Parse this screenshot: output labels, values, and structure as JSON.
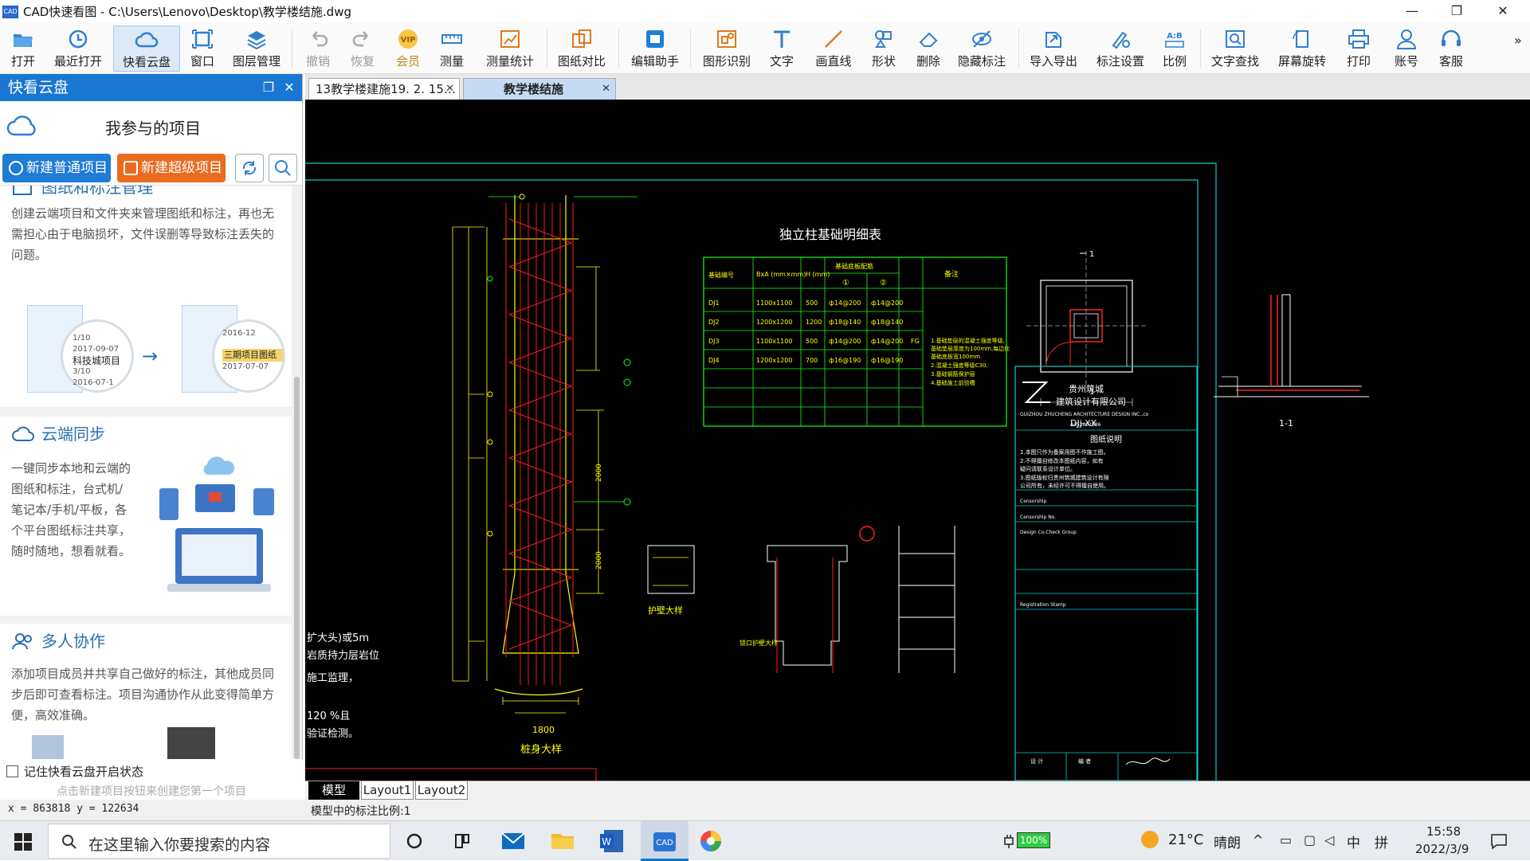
{
  "window": {
    "app_icon": "CAD",
    "title": "CAD快速看图 - C:\\Users\\Lenovo\\Desktop\\教学楼结施.dwg",
    "minimize": "—",
    "restore": "❐",
    "close": "✕"
  },
  "toolbar": {
    "items": [
      {
        "label": "打开",
        "icon": "folder-open-icon"
      },
      {
        "label": "最近打开",
        "icon": "history-icon"
      },
      {
        "label": "快看云盘",
        "icon": "cloud-icon"
      },
      {
        "label": "窗口",
        "icon": "window-icon"
      },
      {
        "label": "图层管理",
        "icon": "layers-icon"
      },
      {
        "label": "撤销",
        "icon": "undo-icon"
      },
      {
        "label": "恢复",
        "icon": "redo-icon"
      },
      {
        "label": "会员",
        "icon": "vip-icon"
      },
      {
        "label": "测量",
        "icon": "ruler-icon"
      },
      {
        "label": "测量统计",
        "icon": "measure-stats-icon"
      },
      {
        "label": "图纸对比",
        "icon": "compare-icon"
      },
      {
        "label": "编辑助手",
        "icon": "edit-assistant-icon"
      },
      {
        "label": "图形识别",
        "icon": "shape-recognize-icon"
      },
      {
        "label": "文字",
        "icon": "text-icon"
      },
      {
        "label": "画直线",
        "icon": "line-icon"
      },
      {
        "label": "形状",
        "icon": "shapes-icon"
      },
      {
        "label": "删除",
        "icon": "eraser-icon"
      },
      {
        "label": "隐藏标注",
        "icon": "hide-annotation-icon"
      },
      {
        "label": "导入导出",
        "icon": "import-export-icon"
      },
      {
        "label": "标注设置",
        "icon": "annotation-settings-icon"
      },
      {
        "label": "比例",
        "icon": "scale-icon"
      },
      {
        "label": "文字查找",
        "icon": "text-search-icon"
      },
      {
        "label": "屏幕旋转",
        "icon": "rotate-screen-icon"
      },
      {
        "label": "打印",
        "icon": "printer-icon"
      },
      {
        "label": "账号",
        "icon": "account-icon"
      },
      {
        "label": "客服",
        "icon": "headset-icon"
      }
    ],
    "vip_badge": "VIP",
    "scale_badge": "A:B",
    "overflow": "»"
  },
  "panel": {
    "title": "快看云盘",
    "project_label": "我参与的项目",
    "new_normal": "新建普通项目",
    "new_super": "新建超级项目",
    "sections": [
      {
        "title": "图纸和标注管理",
        "desc": "创建云端项目和文件夹来管理图纸和标注，再也无需担心由于电脑损坏，文件误删等导致标注丢失的问题。",
        "illus": {
          "left_card": {
            "title": "科技城项目",
            "date": "2017-09-07",
            "count_a": "1/10",
            "count_b": "3/10",
            "date2": "2016-07-1"
          },
          "right_card": {
            "title": "三期项目图纸",
            "date": "2017-07-07",
            "date2": "2016-12"
          }
        }
      },
      {
        "title": "云端同步",
        "desc": "一键同步本地和云端的图纸和标注，台式机/笔记本/手机/平板，各个平台图纸标注共享，随时随地，想看就看。"
      },
      {
        "title": "多人协作",
        "desc": "添加项目成员并共享自己做好的标注，其他成员同步后即可查看标注。项目沟通协作从此变得简单方便，高效准确。"
      }
    ],
    "remember_label": "记住快看云盘开启状态",
    "hint": "点击新建项目按钮来创建您第一个项目",
    "coords": "x = 863818  y = 122634"
  },
  "doc_tabs": [
    {
      "label": "13教学楼建施19. 2. 15…",
      "active": false
    },
    {
      "label": "教学楼结施",
      "active": true
    }
  ],
  "drawing": {
    "table_title": "独立柱基础明细表",
    "table_headers": [
      "基础编号",
      "BxA (mm×mm)",
      "H (mm)",
      "基础底板配筋",
      "备注"
    ],
    "rebar_cols": [
      "①",
      "②"
    ],
    "table_rows": [
      [
        "DJ1",
        "1100x1100",
        "500",
        "ф14@200",
        "ф14@200"
      ],
      [
        "DJ2",
        "1200x1200",
        "1200",
        "ф18@140",
        "ф18@140"
      ],
      [
        "DJ3",
        "1100x1100",
        "500",
        "ф14@200",
        "ф14@200"
      ],
      [
        "DJ4",
        "1200x1200",
        "700",
        "ф16@190",
        "ф16@190"
      ]
    ],
    "dj3_note": "FG",
    "notes": [
      "1.基础垫层的混凝土强度等级,",
      "  基础垫层厚度为100mm,每边比",
      "  基础底板宽100mm.",
      "2.混凝土强度等级C30.",
      "3.基础钢筋保护层",
      "4.基础施工前验槽"
    ],
    "plan_label": "DJj-XX",
    "section_label": "1-1",
    "cut_mark": "1",
    "pile_label": "桩身大样",
    "pile_dims": [
      "1800",
      "2000",
      "2000"
    ],
    "left_texts": [
      "扩大头)或5m",
      "岩质持力层岩位",
      "施工监理，",
      "120 %且",
      "验证检测。"
    ],
    "wall_label": "护壁大样",
    "collar_label": "锁口护壁大样",
    "company_cn": "贵州筑城",
    "company_cn2": "建筑设计有限公司",
    "company_en": "GUIZHOU ZHUCHENG ARCHITECTURE DESIGN INC.,co",
    "cert_no": "A452001586",
    "notes_title": "图纸说明",
    "tb_notes": [
      "1.本图只作为备案用图不作施工图。",
      "2.不得擅自修改本图纸内容，如有",
      "  疑问请联系设计单位。",
      "3.图纸版权归贵州筑城建筑设计有限",
      "  公司所有，未经许可不得擅自使用。"
    ],
    "censorship": "Censorship",
    "censorship_no": "Censorship No.",
    "design_group": "Design Co.Check Group",
    "registration": "Registration Stamp",
    "design_label": "设 计",
    "cg_label": "编 者"
  },
  "layout_tabs": [
    "模型",
    "Layout1",
    "Layout2"
  ],
  "status": "模型中的标注比例:1",
  "taskbar": {
    "search_placeholder": "在这里输入你要搜索的内容",
    "battery": "100%",
    "weather_temp": "21°C",
    "weather_text": "晴朗",
    "ime_lang": "中",
    "ime_mode": "拼",
    "time": "15:58",
    "date": "2022/3/9",
    "accent": "#0078d4"
  }
}
